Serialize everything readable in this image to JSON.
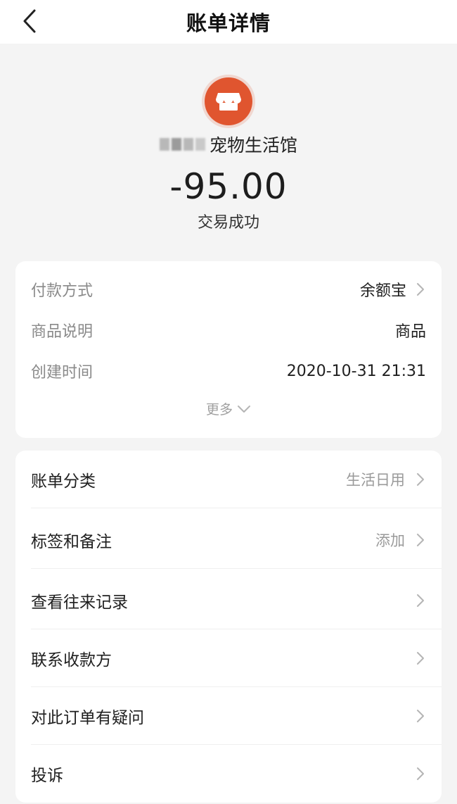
{
  "nav": {
    "title": "账单详情"
  },
  "merchant": {
    "icon": "store-icon",
    "name_suffix": "宠物生活馆",
    "amount": "-95.00",
    "status": "交易成功",
    "accent_color": "#e0552f"
  },
  "details": {
    "rows": [
      {
        "label": "付款方式",
        "value": "余额宝"
      },
      {
        "label": "商品说明",
        "value": "商品"
      },
      {
        "label": "创建时间",
        "value": "2020-10-31 21:31"
      }
    ],
    "more_label": "更多"
  },
  "actions": {
    "items": [
      {
        "label": "账单分类",
        "value": "生活日用"
      },
      {
        "label": "标签和备注",
        "value": "添加"
      },
      {
        "label": "查看往来记录",
        "value": ""
      },
      {
        "label": "联系收款方",
        "value": ""
      },
      {
        "label": "对此订单有疑问",
        "value": ""
      },
      {
        "label": "投诉",
        "value": ""
      }
    ]
  }
}
